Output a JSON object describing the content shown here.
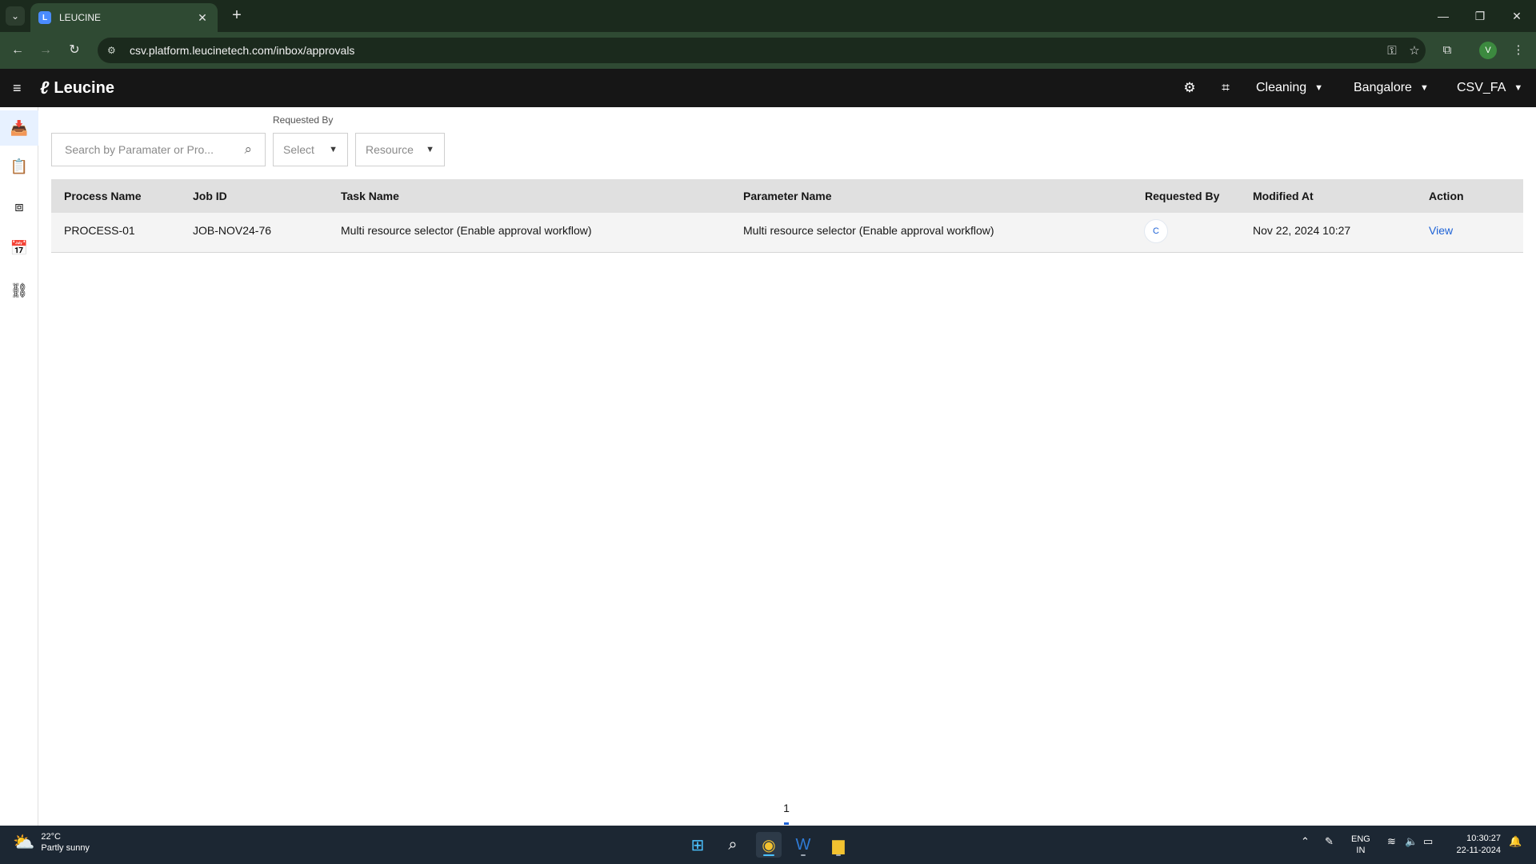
{
  "browser": {
    "tab_title": "LEUCINE",
    "url": "csv.platform.leucinetech.com/inbox/approvals",
    "profile_initial": "V"
  },
  "app": {
    "brand": "Leucine",
    "use_case": "Cleaning",
    "facility": "Bangalore",
    "user": "CSV_FA"
  },
  "filters": {
    "search_placeholder": "Search by Paramater or Pro...",
    "requested_by_label": "Requested By",
    "requested_by_value": "Select",
    "resource_value": "Resource"
  },
  "table": {
    "headers": [
      "Process Name",
      "Job ID",
      "Task Name",
      "Parameter Name",
      "Requested By",
      "Modified At",
      "Action"
    ],
    "rows": [
      {
        "process_name": "PROCESS-01",
        "job_id": "JOB-NOV24-76",
        "task_name": "Multi resource selector (Enable approval workflow)",
        "parameter_name": "Multi resource selector (Enable approval workflow)",
        "requested_by_initial": "C",
        "modified_at": "Nov 22, 2024 10:27",
        "action": "View"
      }
    ]
  },
  "pagination": {
    "current_page": "1"
  },
  "taskbar": {
    "temperature": "22°C",
    "weather": "Partly sunny",
    "lang_line1": "ENG",
    "lang_line2": "IN",
    "time": "10:30:27",
    "date": "22-11-2024"
  },
  "colors": {
    "accent": "#1d62d6",
    "header_bg": "#161616",
    "browser_bg": "#2f4a33"
  }
}
